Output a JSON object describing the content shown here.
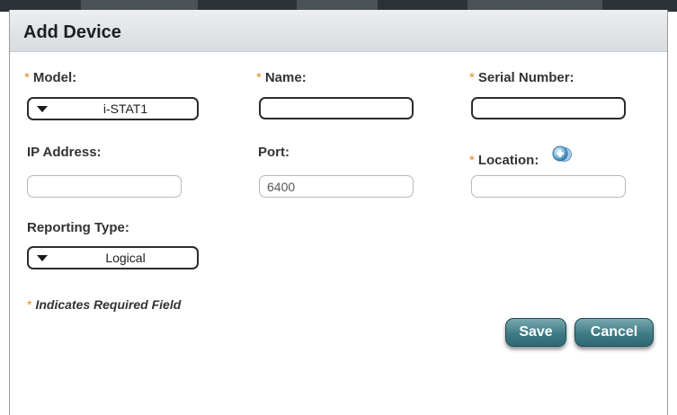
{
  "dialog": {
    "title": "Add Device",
    "required_marker": "*",
    "fields": {
      "model": {
        "label": "Model:",
        "value": "i-STAT1"
      },
      "name": {
        "label": "Name:",
        "value": ""
      },
      "serial_number": {
        "label": "Serial Number:",
        "value": ""
      },
      "ip_address": {
        "label": "IP Address:",
        "value": ""
      },
      "port": {
        "label": "Port:",
        "value": "6400"
      },
      "location": {
        "label": "Location:",
        "value": ""
      },
      "reporting_type": {
        "label": "Reporting Type:",
        "value": "Logical"
      }
    },
    "required_note": "Indicates Required Field",
    "buttons": {
      "save": "Save",
      "cancel": "Cancel"
    }
  },
  "colors": {
    "required_marker": "#e8862a",
    "button_teal": "#3f7a84",
    "header_gray": "#dfe2e5"
  },
  "icons": {
    "add_location": "add-location-icon",
    "dropdown": "caret-down-icon"
  }
}
